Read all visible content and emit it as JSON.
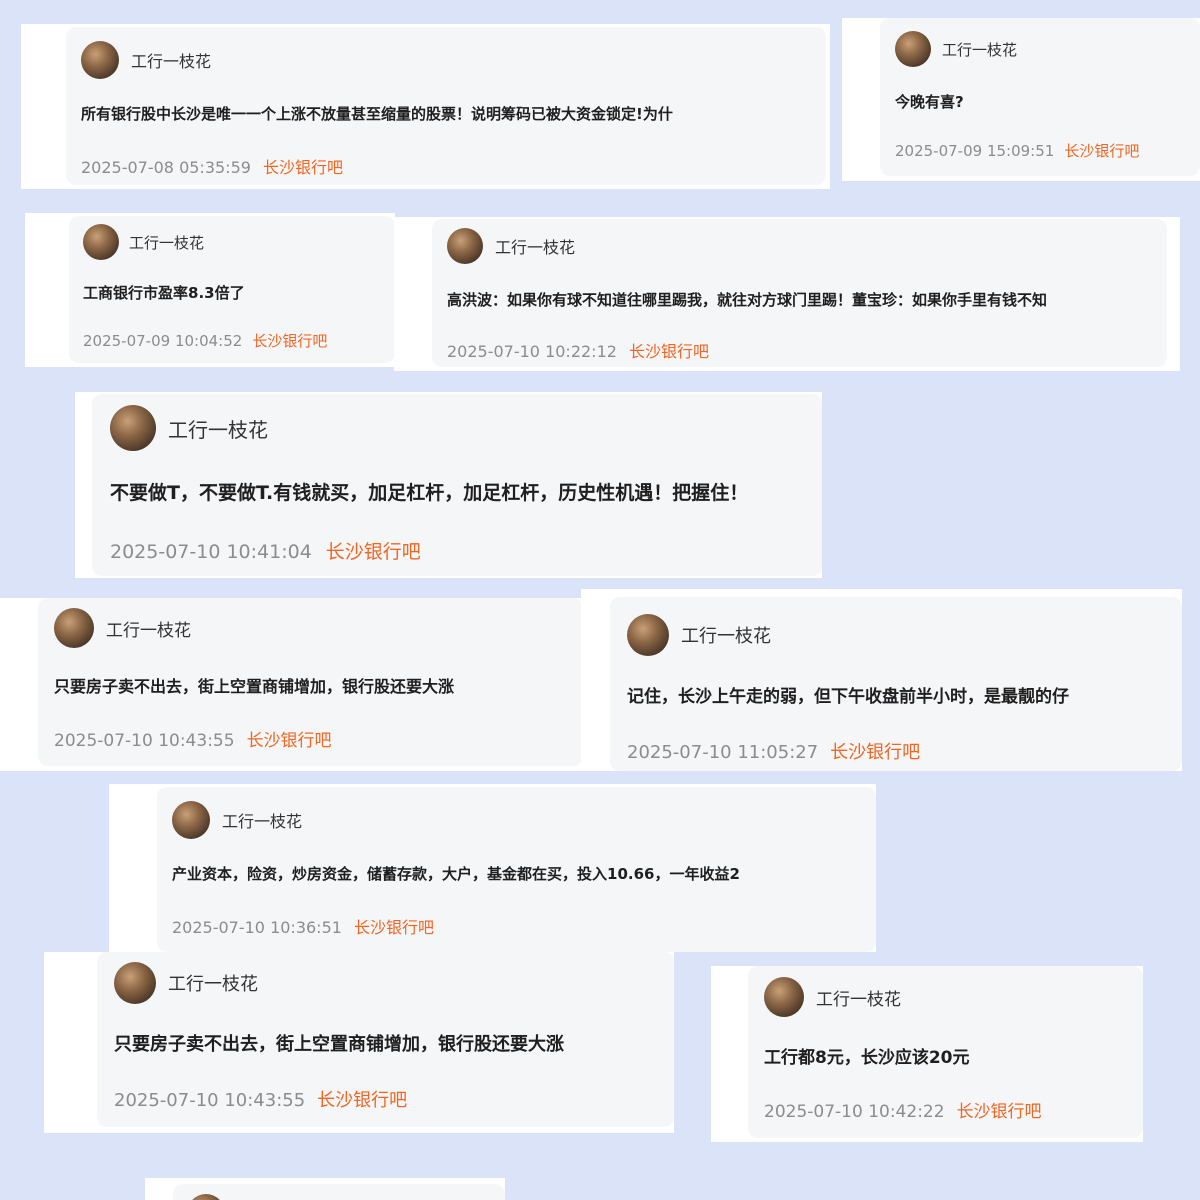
{
  "posts": [
    {
      "user": "工行一枝花",
      "content": "所有银行股中长沙是唯一一个上涨不放量甚至缩量的股票！说明筹码已被大资金锁定!为什",
      "time": "2025-07-08 05:35:59",
      "tag": "长沙银行吧"
    },
    {
      "user": "工行一枝花",
      "content": "今晚有喜?",
      "time": "2025-07-09 15:09:51",
      "tag": "长沙银行吧"
    },
    {
      "user": "工行一枝花",
      "content": "工商银行市盈率8.3倍了",
      "time": "2025-07-09 10:04:52",
      "tag": "长沙银行吧"
    },
    {
      "user": "工行一枝花",
      "content": "高洪波：如果你有球不知道往哪里踢我，就往对方球门里踢！董宝珍：如果你手里有钱不知",
      "time": "2025-07-10 10:22:12",
      "tag": "长沙银行吧"
    },
    {
      "user": "工行一枝花",
      "content": "不要做T，不要做T.有钱就买，加足杠杆，加足杠杆，历史性机遇！把握住！",
      "time": "2025-07-10 10:41:04",
      "tag": "长沙银行吧"
    },
    {
      "user": "工行一枝花",
      "content": "只要房子卖不出去，街上空置商铺增加，银行股还要大涨",
      "time": "2025-07-10 10:43:55",
      "tag": "长沙银行吧"
    },
    {
      "user": "工行一枝花",
      "content": "记住，长沙上午走的弱，但下午收盘前半小时，是最靓的仔",
      "time": "2025-07-10 11:05:27",
      "tag": "长沙银行吧"
    },
    {
      "user": "工行一枝花",
      "content": "产业资本，险资，炒房资金，储蓄存款，大户，基金都在买，投入10.66，一年收益2",
      "time": "2025-07-10 10:36:51",
      "tag": "长沙银行吧"
    },
    {
      "user": "工行一枝花",
      "content": "只要房子卖不出去，街上空置商铺增加，银行股还要大涨",
      "time": "2025-07-10 10:43:55",
      "tag": "长沙银行吧"
    },
    {
      "user": "工行一枝花",
      "content": "工行都8元，长沙应该20元",
      "time": "2025-07-10 10:42:22",
      "tag": "长沙银行吧"
    }
  ]
}
